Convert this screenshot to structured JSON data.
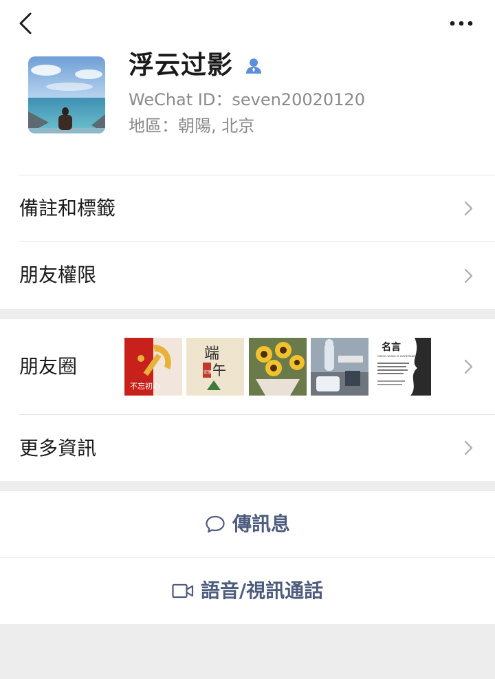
{
  "profile": {
    "nickname": "浮云过影",
    "wechat_id": "WeChat ID：seven20020120",
    "region": "地區：朝陽, 北京"
  },
  "rows": {
    "remarks_tags": "備註和標籤",
    "friend_permissions": "朋友權限",
    "moments": "朋友圈",
    "more_info": "更多資訊"
  },
  "moments_thumbs": [
    {
      "text": "不忘初心"
    },
    {
      "text_top": "端",
      "text_mid": "午",
      "text_seal": "安康"
    },
    {
      "text": ""
    },
    {
      "text": ""
    },
    {
      "title": "名言",
      "subtitle": "FAMOUS WORDS OF ENTREPRENEURS"
    }
  ],
  "actions": {
    "message": "傳訊息",
    "voice_video": "語音/視訊通話"
  },
  "colors": {
    "accent_text": "#4d5b7c",
    "person_icon": "#5b8fd8",
    "chevron": "#b2b2b2",
    "background": "#ededed"
  },
  "icons": [
    "back-arrow-icon",
    "more-dots-icon",
    "person-icon",
    "chevron-right-icon",
    "chat-bubble-icon",
    "video-camera-icon"
  ]
}
